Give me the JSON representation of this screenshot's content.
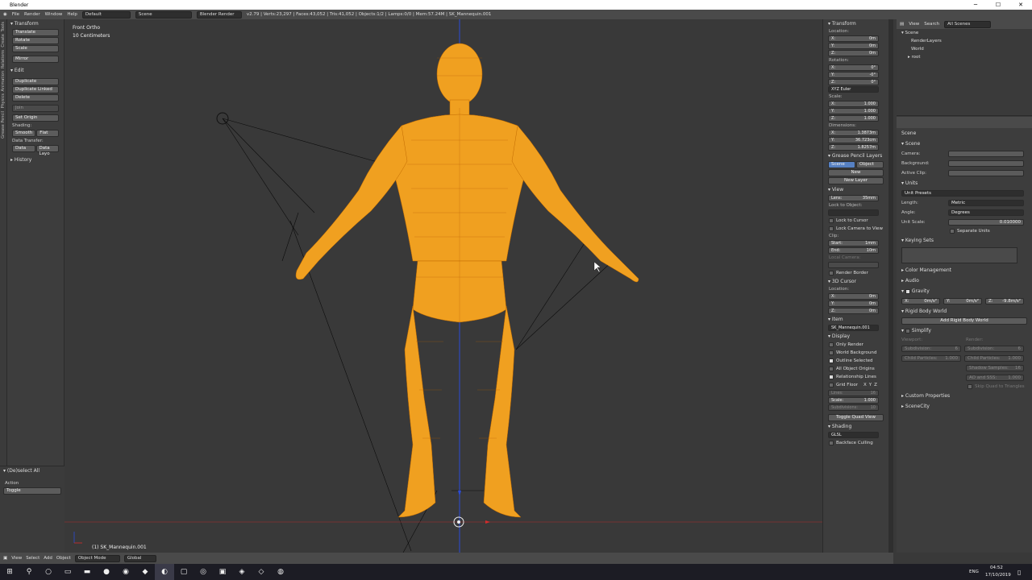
{
  "window": {
    "title": "Blender",
    "min": "─",
    "max": "☐",
    "close": "✕"
  },
  "menus": [
    "File",
    "Render",
    "Window",
    "Help"
  ],
  "layout_field": "Default",
  "scene_field": "Scene",
  "render_engine": "Blender Render",
  "info_stats": "v2.79 | Verts:23,297 | Faces:43,052 | Tris:41,052 | Objects:1/2 | Lamps:0/0 | Mem:57.24M | SK_Mannequin.001",
  "tool_tabs": [
    "Tools",
    "Create",
    "Relations",
    "Animation",
    "Physics",
    "Grease Pencil"
  ],
  "tools": {
    "transform_header": "Transform",
    "transform": [
      "Translate",
      "Rotate",
      "Scale",
      "Mirror"
    ],
    "edit_header": "Edit",
    "edit": [
      "Duplicate",
      "Duplicate Linked",
      "Delete",
      "Join"
    ],
    "set_origin": "Set Origin",
    "shading_label": "Shading:",
    "shading": [
      "Smooth",
      "Flat"
    ],
    "data_transfer_label": "Data Transfer:",
    "data_transfer": [
      "Data",
      "Data Layo"
    ],
    "history": "History"
  },
  "op_panel": {
    "title": "(De)select All",
    "action_label": "Action",
    "action_value": "Toggle"
  },
  "viewport": {
    "view_name": "Front Ortho",
    "grid_scale": "10 Centimeters",
    "object_label": "(1) SK_Mannequin.001",
    "wire_color": "#f5a623",
    "bg_color": "#393939"
  },
  "view_header": {
    "menus": [
      "View",
      "Select",
      "Add",
      "Object"
    ],
    "mode": "Object Mode",
    "orientation": "Global"
  },
  "npanel": {
    "transform": "Transform",
    "location": "Location:",
    "loc": [
      [
        "X:",
        "0m"
      ],
      [
        "Y:",
        "0m"
      ],
      [
        "Z:",
        "0m"
      ]
    ],
    "rotation": "Rotation:",
    "rot": [
      [
        "X:",
        "0°"
      ],
      [
        "Y:",
        "-0°"
      ],
      [
        "Z:",
        "0°"
      ]
    ],
    "rot_mode": "XYZ Euler",
    "scale": "Scale:",
    "scl": [
      [
        "X:",
        "1.000"
      ],
      [
        "Y:",
        "1.000"
      ],
      [
        "Z:",
        "1.000"
      ]
    ],
    "dimensions": "Dimensions:",
    "dim": [
      [
        "X:",
        "1.3873m"
      ],
      [
        "Y:",
        "36.723cm"
      ],
      [
        "Z:",
        "1.8257m"
      ]
    ],
    "grease": "Grease Pencil Layers",
    "gp_tabs": [
      "Scene",
      "Object"
    ],
    "gp_new": "New",
    "gp_new_layer": "New Layer",
    "view": "View",
    "lens": [
      "Lens:",
      "35mm"
    ],
    "lock_obj": "Lock to Object:",
    "lock_cursor": "Lock to Cursor",
    "lock_cam": "Lock Camera to View",
    "clip": "Clip:",
    "clip_start": [
      "Start:",
      "1mm"
    ],
    "clip_end": [
      "End:",
      "10m"
    ],
    "local_camera": "Local Camera:",
    "render_border": "Render Border",
    "cursor": "3D Cursor",
    "cur_loc": "Location:",
    "cur": [
      [
        "X:",
        "0m"
      ],
      [
        "Y:",
        "0m"
      ],
      [
        "Z:",
        "0m"
      ]
    ],
    "item": "Item",
    "item_name": "SK_Mannequin.001",
    "display": "Display",
    "disp": [
      [
        "Only Render",
        false
      ],
      [
        "World Background",
        false
      ],
      [
        "Outline Selected",
        true
      ],
      [
        "All Object Origins",
        false
      ],
      [
        "Relationship Lines",
        true
      ]
    ],
    "grid_floor": "Grid Floor",
    "axes": [
      "X",
      "Y",
      "Z"
    ],
    "lines": [
      "Lines:",
      "16"
    ],
    "grid_scale": [
      "Scale:",
      "1.000"
    ],
    "subdiv": [
      "Subdivisions:",
      "10"
    ],
    "quad": "Toggle Quad View",
    "shading": "Shading",
    "shade_mode": "GLSL",
    "backface": "Backface Culling"
  },
  "outliner": {
    "menus": [
      "View",
      "Search"
    ],
    "scenes": "All Scenes",
    "rows": [
      "Scene",
      "RenderLayers",
      "World",
      "root"
    ]
  },
  "props": {
    "crumb": "Scene",
    "scene": "Scene",
    "camera": "Camera:",
    "background": "Background:",
    "active_clip": "Active Clip:",
    "units": "Units",
    "unit_presets": "Unit Presets",
    "length": [
      "Length:",
      "Metric"
    ],
    "angle": [
      "Angle:",
      "Degrees"
    ],
    "unit_scale": [
      "Unit Scale:",
      "0.010000"
    ],
    "separate": "Separate Units",
    "keying": "Keying Sets",
    "color_mgmt": "Color Management",
    "audio": "Audio",
    "gravity": "Gravity",
    "grav": [
      [
        "X:",
        "0m/s²"
      ],
      [
        "Y:",
        "0m/s²"
      ],
      [
        "Z:",
        "-9.8m/s²"
      ]
    ],
    "rigid": "Rigid Body World",
    "add_rigid": "Add Rigid Body World",
    "simplify": "Simplify",
    "viewport": "Viewport:",
    "render": "Render:",
    "simp_rows": [
      [
        "Subdivision:",
        "6"
      ],
      [
        "Subdivision:",
        "6"
      ],
      [
        "Child Particles:",
        "1.000"
      ],
      [
        "Child Particles:",
        "1.000"
      ],
      [
        "Shadow Samples:",
        "16"
      ],
      [
        "AO and SSS:",
        "1.000"
      ]
    ],
    "skip_quad": "Skip Quad to Triangles",
    "custom": "Custom Properties",
    "scenecity": "SceneCity"
  },
  "taskbar": {
    "lang": "ENG",
    "time": "04:52",
    "date": "17/10/2019"
  }
}
